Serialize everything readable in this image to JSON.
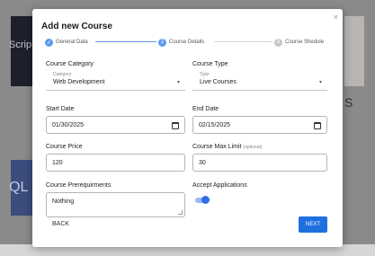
{
  "background": {
    "left_text": "Scrip",
    "right_letter": "S",
    "lower_text": "QL"
  },
  "modal": {
    "title": "Add new Course",
    "close_symbol": "×",
    "stepper": {
      "steps": [
        {
          "label": "General Data",
          "state": "done",
          "marker": "✓"
        },
        {
          "label": "Course Details",
          "state": "active",
          "marker": "2"
        },
        {
          "label": "Course Shedule",
          "state": "pending",
          "marker": "3"
        }
      ]
    },
    "form": {
      "course_category": {
        "label": "Course Category",
        "mini_label": "Category",
        "value": "Web Development"
      },
      "course_type": {
        "label": "Course Type",
        "mini_label": "Type",
        "value": "Live Courses"
      },
      "start_date": {
        "label": "Start Date",
        "value": "01/30/2025"
      },
      "end_date": {
        "label": "End Date",
        "value": "02/15/2025"
      },
      "course_price": {
        "label": "Course Price",
        "value": "120"
      },
      "course_max_limit": {
        "label": "Course Max Limit",
        "optional": "(optional)",
        "value": "30"
      },
      "course_prerequisites": {
        "label": "Course Prerequirments",
        "value": "Nothing"
      },
      "accept_applications": {
        "label": "Accept Applications",
        "enabled": true
      }
    },
    "buttons": {
      "back": "BACK",
      "next": "NEXT"
    },
    "colors": {
      "primary": "#1f6fe0",
      "step_done": "#5b9bf0",
      "step_pending": "#c8c8c8"
    }
  }
}
